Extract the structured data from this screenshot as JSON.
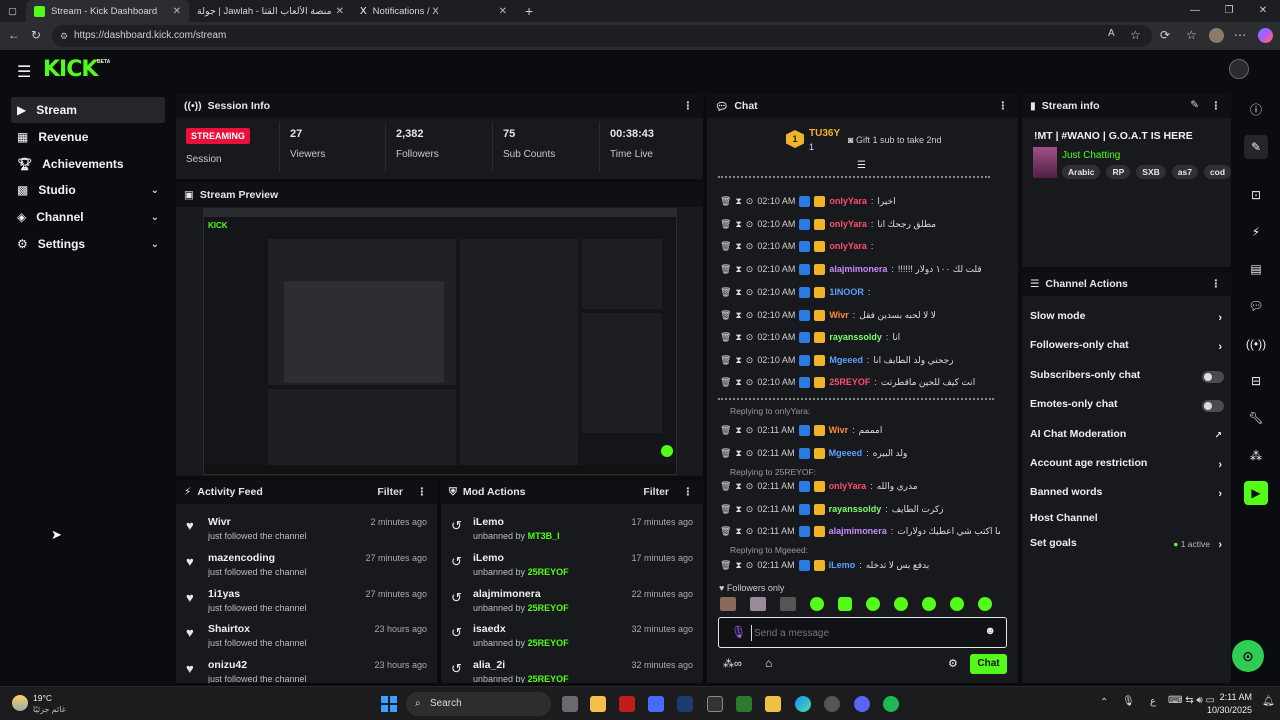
{
  "browser": {
    "tabs": [
      {
        "title": "Stream - Kick Dashboard",
        "active": true
      },
      {
        "title": "جولة | Jawlah - منصة الألعاب القتا...",
        "active": false
      },
      {
        "title": "Notifications / X",
        "active": false
      }
    ],
    "new_tab": "+",
    "url": "https://dashboard.kick.com/stream"
  },
  "header": {
    "logo": "KICK",
    "logo_badge": "BETA"
  },
  "sidebar": {
    "items": [
      {
        "label": "Stream",
        "selected": true,
        "icon": "stream-icon"
      },
      {
        "label": "Revenue",
        "icon": "revenue-icon"
      },
      {
        "label": "Achievements",
        "icon": "trophy-icon"
      },
      {
        "label": "Studio",
        "icon": "studio-icon",
        "expandable": true
      },
      {
        "label": "Channel",
        "icon": "channel-icon",
        "expandable": true
      },
      {
        "label": "Settings",
        "icon": "gear-icon",
        "expandable": true
      }
    ]
  },
  "session_info": {
    "title": "Session Info",
    "status": "STREAMING",
    "status_label": "Session",
    "stats": [
      {
        "value": "27",
        "label": "Viewers"
      },
      {
        "value": "2,382",
        "label": "Followers"
      },
      {
        "value": "75",
        "label": "Sub Counts"
      },
      {
        "value": "00:38:43",
        "label": "Time Live"
      }
    ]
  },
  "stream_preview": {
    "title": "Stream Preview"
  },
  "activity_feed": {
    "title": "Activity Feed",
    "filter": "Filter",
    "items": [
      {
        "name": "Wivr",
        "action": "just followed the channel",
        "time": "2 minutes ago"
      },
      {
        "name": "mazencoding",
        "action": "just followed the channel",
        "time": "27 minutes ago"
      },
      {
        "name": "1i1yas",
        "action": "just followed the channel",
        "time": "27 minutes ago"
      },
      {
        "name": "Shairtox",
        "action": "just followed the channel",
        "time": "23 hours ago"
      },
      {
        "name": "onizu42",
        "action": "just followed the channel",
        "time": "23 hours ago"
      }
    ]
  },
  "mod_actions": {
    "title": "Mod Actions",
    "filter": "Filter",
    "items": [
      {
        "name": "iLemo",
        "action": "unbanned by",
        "by": "MT3B_I",
        "time": "17 minutes ago"
      },
      {
        "name": "iLemo",
        "action": "unbanned by",
        "by": "25REYOF",
        "time": "17 minutes ago"
      },
      {
        "name": "alajmimonera",
        "action": "unbanned by",
        "by": "25REYOF",
        "time": "22 minutes ago"
      },
      {
        "name": "isaedx",
        "action": "unbanned by",
        "by": "25REYOF",
        "time": "32 minutes ago"
      },
      {
        "name": "alia_2i",
        "action": "unbanned by",
        "by": "25REYOF",
        "time": "32 minutes ago"
      }
    ]
  },
  "chat": {
    "title": "Chat",
    "top_gifter": "TU36Y",
    "top_gifter_count": "1",
    "gift_prompt": "Gift 1 sub to take 2nd",
    "messages": [
      {
        "time": "02:10 AM",
        "user": "onlyYara",
        "color": "#ff4d6d",
        "text": "اخيرا"
      },
      {
        "time": "02:10 AM",
        "user": "onlyYara",
        "color": "#ff4d6d",
        "text": "مطلق رجحك انا"
      },
      {
        "time": "02:10 AM",
        "user": "onlyYara",
        "color": "#ff4d6d",
        "text": ""
      },
      {
        "time": "02:10 AM",
        "user": "alajmimonera",
        "color": "#c58cff",
        "text": "!!!!!! قلت لك ١٠٠ دولار"
      },
      {
        "time": "02:10 AM",
        "user": "1INOOR",
        "color": "#5aa0ff",
        "text": ""
      },
      {
        "time": "02:10 AM",
        "user": "Wivr",
        "color": "#ff8a3d",
        "text": "لا لا لحبه بسدين فقل"
      },
      {
        "time": "02:10 AM",
        "user": "rayanssoldy",
        "color": "#7dff6a",
        "text": "انا"
      },
      {
        "time": "02:10 AM",
        "user": "Mgeeed",
        "color": "#5aa0ff",
        "text": "رجحني ولد الطايف انا"
      },
      {
        "time": "02:10 AM",
        "user": "25REYOF",
        "color": "#ff4d6d",
        "text": "انت كيف للجين ماقطرتت"
      },
      {
        "time": "02:11 AM",
        "user": "Wivr",
        "color": "#ff8a3d",
        "text": "امممم",
        "reply": "Replying to onlyYara:"
      },
      {
        "time": "02:11 AM",
        "user": "Mgeeed",
        "color": "#5aa0ff",
        "text": "ولد البيره"
      },
      {
        "time": "02:11 AM",
        "user": "onlyYara",
        "color": "#ff4d6d",
        "text": "مدري والله",
        "reply": "Replying to 25REYOF:"
      },
      {
        "time": "02:11 AM",
        "user": "rayanssoldy",
        "color": "#7dff6a",
        "text": "زكرت الطايف"
      },
      {
        "time": "02:11 AM",
        "user": "alajmimonera",
        "color": "#c58cff",
        "text": "ترا ني ما اكتب شي اعطيك دولارات"
      },
      {
        "time": "02:11 AM",
        "user": "iLemo",
        "color": "#5aa0ff",
        "text": "بدفع بس لا تدخله",
        "reply": "Replying to Mgeeed:"
      }
    ],
    "followers_only": "Followers only",
    "input_placeholder": "Send a message",
    "send": "Chat"
  },
  "stream_info": {
    "title": "Stream info",
    "stream_title": "!MT | #WANO | G.O.A.T IS HERE",
    "category": "Just Chatting",
    "tags": [
      "Arabic",
      "RP",
      "SXB",
      "as7",
      "cod"
    ]
  },
  "channel_actions": {
    "title": "Channel Actions",
    "items": [
      {
        "label": "Slow mode",
        "type": "chevron"
      },
      {
        "label": "Followers-only chat",
        "type": "chevron"
      },
      {
        "label": "Subscribers-only chat",
        "type": "toggle"
      },
      {
        "label": "Emotes-only chat",
        "type": "toggle"
      },
      {
        "label": "AI Chat Moderation",
        "type": "external"
      },
      {
        "label": "Account age restriction",
        "type": "chevron"
      },
      {
        "label": "Banned words",
        "type": "chevron"
      },
      {
        "label": "Host Channel",
        "type": "none"
      },
      {
        "label": "Set goals",
        "type": "chevron",
        "extra": "1 active"
      }
    ]
  },
  "taskbar": {
    "weather_temp": "19°C",
    "weather_desc": "غائم جزئيًا",
    "search": "Search",
    "time": "2:11 AM",
    "date": "10/30/2025",
    "lang": "ع"
  },
  "colors": {
    "accent": "#53fc18",
    "live": "#e9113c",
    "bg": "#0b0c0f",
    "panel": "#18191d"
  }
}
